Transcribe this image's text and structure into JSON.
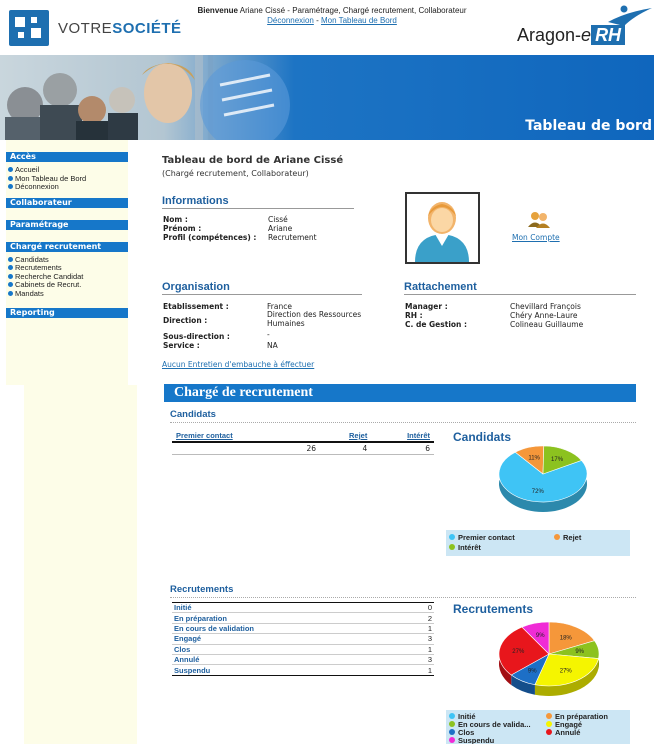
{
  "header": {
    "logo_votre": "VOTRE",
    "logo_societe": "SOCIÉTÉ",
    "welcome_bold": "Bienvenue",
    "welcome_text": " Ariane Cissé - Paramétrage, Chargé recrutement, Collaborateur",
    "logout": "Déconnexion",
    "sep": " - ",
    "dashboard_link": "Mon Tableau de Bord",
    "brand_a": "Aragon-",
    "brand_e": "e",
    "brand_rh": "RH"
  },
  "banner": {
    "title": "Tableau de bord"
  },
  "sidebar": {
    "sections": [
      {
        "title": "Accès",
        "items": [
          "Accueil",
          "Mon Tableau de Bord",
          "Déconnexion"
        ]
      },
      {
        "title": "Collaborateur",
        "items": []
      },
      {
        "title": "Paramétrage",
        "items": []
      },
      {
        "title": "Chargé recrutement",
        "items": [
          "Candidats",
          "Recrutements",
          "Recherche Candidat",
          "Cabinets de Recrut.",
          "Mandats"
        ]
      },
      {
        "title": "Reporting",
        "items": []
      }
    ]
  },
  "page": {
    "title": "Tableau de bord de Ariane Cissé",
    "subtitle": "(Chargé recrutement, Collaborateur)"
  },
  "informations": {
    "heading": "Informations",
    "rows": [
      {
        "key": "Nom :",
        "value": "Cissé"
      },
      {
        "key": "Prénom :",
        "value": "Ariane"
      },
      {
        "key": "Profil (compétences) :",
        "value": "Recrutement"
      }
    ]
  },
  "account": {
    "label": "Mon Compte"
  },
  "organisation": {
    "heading": "Organisation",
    "rows": [
      {
        "key": "Etablissement :",
        "value": "France"
      },
      {
        "key": "Direction :",
        "value": "Direction des Ressources Humaines"
      },
      {
        "key": "Sous-direction :",
        "value": "-"
      },
      {
        "key": "Service :",
        "value": "NA"
      }
    ]
  },
  "rattachement": {
    "heading": "Rattachement",
    "rows": [
      {
        "key": "Manager :",
        "value": "Chevillard François"
      },
      {
        "key": "RH :",
        "value": "Chéry Anne-Laure"
      },
      {
        "key": "C. de Gestion :",
        "value": "Colineau Guillaume"
      }
    ]
  },
  "entretien_link": "Aucun Entretien d'embauche à éffectuer",
  "recruiter": {
    "band_title": "Chargé de recrutement",
    "candidats_heading": "Candidats",
    "candidats_table": {
      "headers": [
        "Premier contact",
        "Rejet",
        "Intérêt"
      ],
      "values": [
        "26",
        "4",
        "6"
      ]
    },
    "recrutements_heading": "Recrutements",
    "recrutements_table": [
      {
        "label": "Initié",
        "value": "0"
      },
      {
        "label": "En préparation",
        "value": "2"
      },
      {
        "label": "En cours de validation",
        "value": "1"
      },
      {
        "label": "Engagé",
        "value": "3"
      },
      {
        "label": "Clos",
        "value": "1"
      },
      {
        "label": "Annulé",
        "value": "3"
      },
      {
        "label": "Suspendu",
        "value": "1"
      }
    ]
  },
  "chart_data": [
    {
      "type": "pie",
      "title": "Candidats",
      "categories": [
        "Premier contact",
        "Rejet",
        "Intérêt"
      ],
      "values": [
        26,
        4,
        6
      ],
      "percent_labels": [
        "72%",
        "11%",
        "17%"
      ],
      "colors": [
        "#3fc4f5",
        "#f5973a",
        "#8cc21f"
      ],
      "legend": [
        "Premier contact",
        "Rejet",
        "Intérêt"
      ]
    },
    {
      "type": "pie",
      "title": "Recrutements",
      "categories": [
        "Initié",
        "En préparation",
        "En cours de validation",
        "Engagé",
        "Clos",
        "Annulé",
        "Suspendu"
      ],
      "values": [
        0,
        2,
        1,
        3,
        1,
        3,
        1
      ],
      "percent_labels": [
        "",
        "18%",
        "9%",
        "27%",
        "9%",
        "27%",
        "9%"
      ],
      "colors": [
        "#3fc4f5",
        "#f5973a",
        "#8cc21f",
        "#f5f500",
        "#1d6fc6",
        "#e8161c",
        "#f02bd6"
      ],
      "legend": [
        "Initié",
        "En préparation",
        "En cours de valida...",
        "Engagé",
        "Clos",
        "Annulé",
        "Suspendu"
      ]
    }
  ]
}
